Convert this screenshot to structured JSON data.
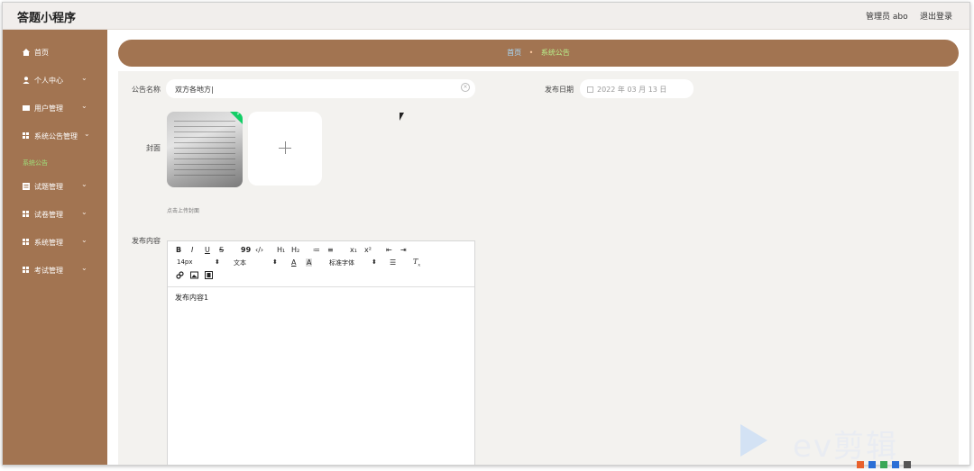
{
  "app": {
    "title": "答题小程序"
  },
  "header": {
    "user_label": "管理员 abo",
    "logout": "退出登录"
  },
  "sidebar": {
    "items": [
      {
        "label": "首页",
        "icon": "home-icon"
      },
      {
        "label": "个人中心",
        "icon": "user-icon"
      },
      {
        "label": "用户管理",
        "icon": "id-card-icon"
      },
      {
        "label": "系统公告管理",
        "icon": "grid-icon"
      },
      {
        "label": "试题管理",
        "icon": "list-icon"
      },
      {
        "label": "试卷管理",
        "icon": "grid-icon"
      },
      {
        "label": "系统管理",
        "icon": "grid-icon"
      },
      {
        "label": "考试管理",
        "icon": "grid-icon"
      }
    ],
    "active_sub": "系统公告"
  },
  "breadcrumb": {
    "home": "首页",
    "separator": "•",
    "current": "系统公告"
  },
  "form": {
    "title_label": "公告名称",
    "title_value": "双方各地方|",
    "date_label": "发布日期",
    "date_value": "2022 年 03 月 13 日",
    "cover_label": "封面",
    "upload_tip": "点击上传封面",
    "content_label": "发布内容"
  },
  "editor": {
    "toolbar_row1": [
      "B",
      "I",
      "U",
      "S",
      "99",
      "‹/›",
      "H₁",
      "H₂",
      "≔",
      "≡",
      "x₁",
      "x²",
      "⇤",
      "⇥"
    ],
    "font_size": "14px",
    "format": "文本",
    "font_family": "标准字体",
    "content": "发布内容1"
  },
  "watermark": {
    "text": "ev剪辑"
  },
  "colors": {
    "brand": "#a27451",
    "panel": "#f3f2ef",
    "accent_green": "#13ce66"
  }
}
